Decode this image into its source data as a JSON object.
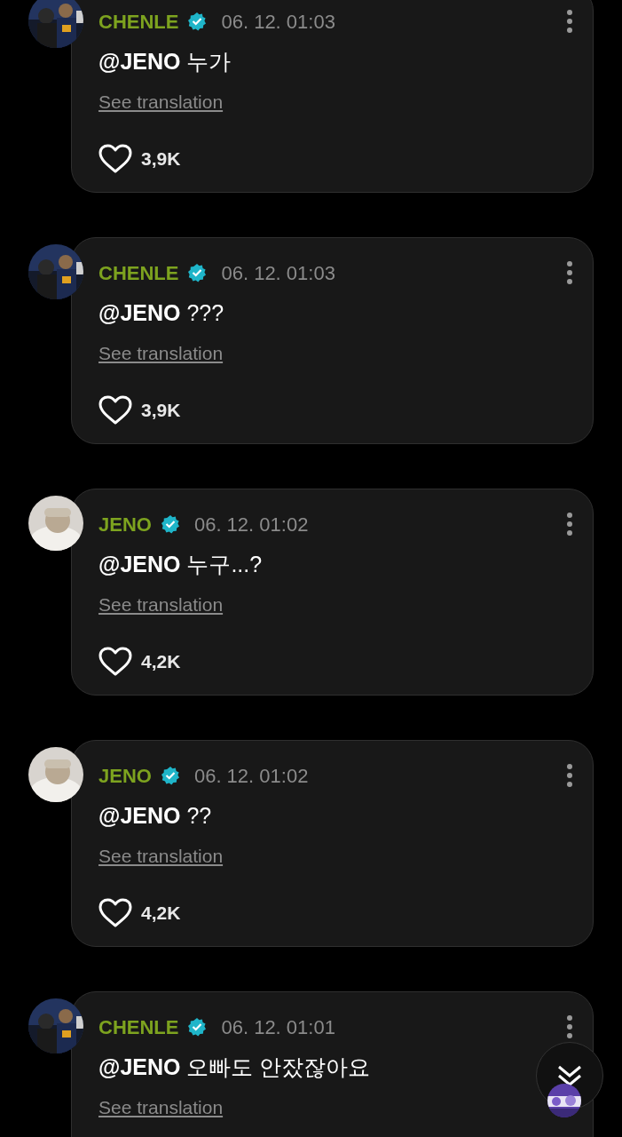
{
  "comments": [
    {
      "author": "CHENLE",
      "verified": true,
      "time": "06. 12. 01:03",
      "text": "**@JENO** 누가",
      "translation_link": "See translation",
      "likes": "3,9K"
    },
    {
      "author": "CHENLE",
      "verified": true,
      "time": "06. 12. 01:03",
      "text": "**@JENO** ???",
      "translation_link": "See translation",
      "likes": "3,9K"
    },
    {
      "author": "JENO",
      "verified": true,
      "time": "06. 12. 01:02",
      "text": "**@JENO** 누구...?",
      "translation_link": "See translation",
      "likes": "4,2K"
    },
    {
      "author": "JENO",
      "verified": true,
      "time": "06. 12. 01:02",
      "text": "**@JENO** ??",
      "translation_link": "See translation",
      "likes": "4,2K"
    },
    {
      "author": "CHENLE",
      "verified": true,
      "time": "06. 12. 01:01",
      "text": "**@JENO** 오빠도 안잤잖아요",
      "translation_link": "See translation"
    }
  ]
}
